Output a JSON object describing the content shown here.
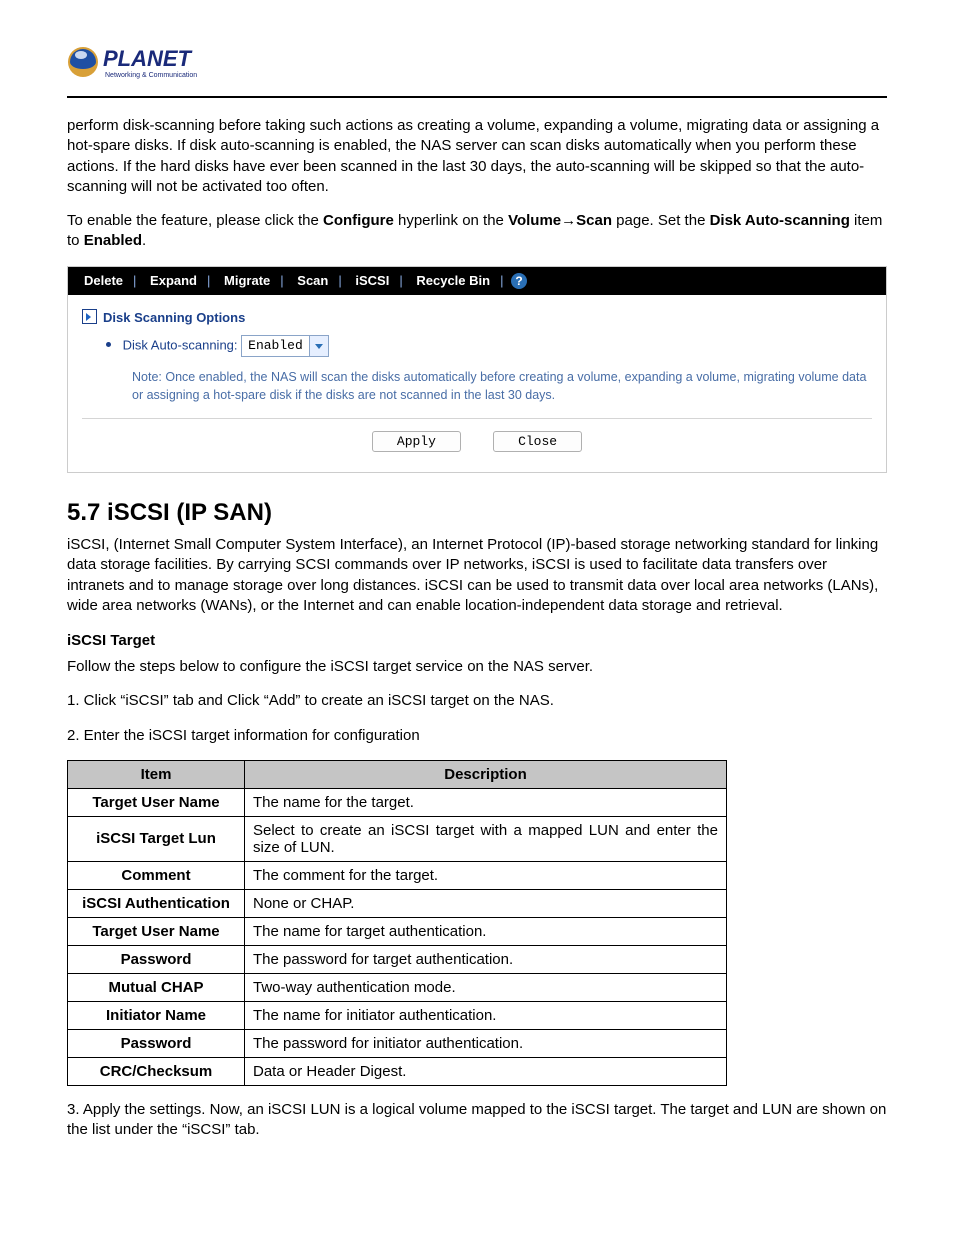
{
  "logo": {
    "brand": "PLANET",
    "tagline": "Networking & Communication"
  },
  "intro": {
    "p1": "perform disk-scanning before taking such actions as creating a volume, expanding a volume, migrating data or assigning a hot-spare disks. If disk auto-scanning is enabled, the NAS server can scan disks automatically when you perform these actions. If the hard disks have ever been scanned in the last 30 days, the auto-scanning will be skipped so that the auto-scanning will not be activated too often.",
    "p2_pre": "To enable the feature, please click the ",
    "p2_cfg": "Configure",
    "p2_mid": " hyperlink on the ",
    "p2_vol": "Volume→Scan",
    "p2_aft": " page. Set the ",
    "p2_das": "Disk Auto-scanning",
    "p2_to": " item to ",
    "p2_en": "Enabled",
    "p2_end": "."
  },
  "ui": {
    "tabs": [
      "Delete",
      "Expand",
      "Migrate",
      "Scan",
      "iSCSI",
      "Recycle Bin"
    ],
    "options_head": "Disk Scanning Options",
    "auto_label": "Disk Auto-scanning:",
    "auto_value": "Enabled",
    "note": "Note: Once enabled, the NAS will scan the disks automatically before creating a volume, expanding a volume, migrating volume data or assigning a hot-spare disk if the disks are not scanned in the last 30 days.",
    "btn_apply": "Apply",
    "btn_close": "Close"
  },
  "section": {
    "heading": "5.7 iSCSI (IP SAN)",
    "desc": "iSCSI, (Internet Small Computer System Interface), an Internet Protocol (IP)-based storage networking standard for linking data storage facilities. By carrying SCSI commands over IP networks, iSCSI is used to facilitate data transfers over intranets and to manage storage over long distances. iSCSI can be used to transmit data over local area networks (LANs), wide area networks (WANs), or the Internet and can enable location-independent data storage and retrieval.",
    "sub": "iSCSI Target",
    "follow": "Follow the steps below to configure the iSCSI target service on the NAS server.",
    "step1": "1. Click “iSCSI” tab and Click “Add” to create an iSCSI target on the NAS.",
    "step2": "2. Enter the iSCSI target information for configuration",
    "step3": "3. Apply the settings. Now, an iSCSI LUN is a logical volume mapped to the iSCSI target. The target and LUN are shown on the list under the “iSCSI” tab."
  },
  "table": {
    "head_item": "Item",
    "head_desc": "Description",
    "rows": [
      {
        "item": "Target User Name",
        "desc": "The name for the target."
      },
      {
        "item": "iSCSI Target Lun",
        "desc": "Select to create an iSCSI target with a mapped LUN and enter the size of LUN.",
        "justify": true
      },
      {
        "item": "Comment",
        "desc": "The comment for the target."
      },
      {
        "item": "iSCSI Authentication",
        "desc": "None or CHAP."
      },
      {
        "item": "Target User Name",
        "desc": "The name for target authentication."
      },
      {
        "item": "Password",
        "desc": "The password for target authentication."
      },
      {
        "item": "Mutual CHAP",
        "desc": "Two-way authentication mode."
      },
      {
        "item": "Initiator Name",
        "desc": "The name for initiator authentication."
      },
      {
        "item": "Password",
        "desc": "The password for initiator authentication."
      },
      {
        "item": "CRC/Checksum",
        "desc": "Data or Header Digest."
      }
    ]
  }
}
